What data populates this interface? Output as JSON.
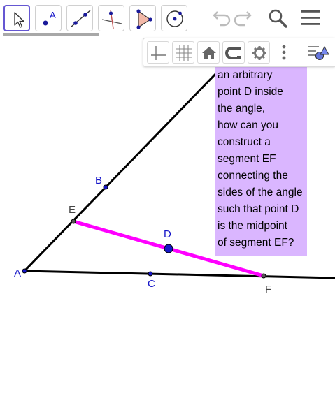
{
  "toolbar": {
    "tools": [
      {
        "name": "move-tool",
        "icon": "cursor-arrow-icon",
        "active": true
      },
      {
        "name": "point-tool",
        "icon": "point-icon",
        "sample_label": "A"
      },
      {
        "name": "line-tool",
        "icon": "line-through-points-icon"
      },
      {
        "name": "perpendicular-line-tool",
        "icon": "perpendicular-line-icon"
      },
      {
        "name": "polygon-tool",
        "icon": "polygon-icon"
      },
      {
        "name": "circle-tool",
        "icon": "circle-center-point-icon"
      }
    ],
    "undo_icon": "undo-icon",
    "redo_icon": "redo-icon",
    "search_icon": "search-icon",
    "menu_icon": "hamburger-menu-icon"
  },
  "style_bar": {
    "buttons": [
      "axes-icon",
      "grid-icon",
      "home-icon",
      "point-capturing-icon",
      "settings-gear-icon",
      "more-vertical-icon"
    ],
    "toggle_icon": "style-bar-toggle-icon"
  },
  "text_box": {
    "lines": [
      "an arbitrary",
      "point D inside",
      "the angle,",
      "how can you",
      "construct a",
      "segment EF",
      "connecting the",
      "sides of the angle",
      "such that point D",
      "is the midpoint",
      "of segment EF?"
    ],
    "background": "#dab6ff"
  },
  "points": [
    {
      "label": "A",
      "color": "#1515c8"
    },
    {
      "label": "B",
      "color": "#1515c8"
    },
    {
      "label": "C",
      "color": "#1515c8"
    },
    {
      "label": "D",
      "color": "#1515c8"
    },
    {
      "label": "E",
      "color": "#444444"
    },
    {
      "label": "F",
      "color": "#444444"
    }
  ],
  "colors": {
    "segment_ef": "#ff00ff",
    "rays": "#000000",
    "active_tool_border": "#6557d2"
  }
}
